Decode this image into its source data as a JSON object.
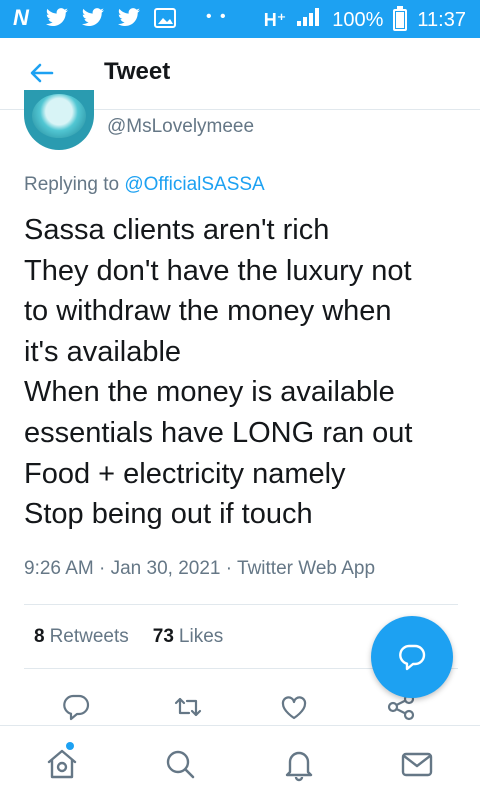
{
  "status_bar": {
    "network": "H⁺",
    "battery": "100%",
    "time": "11:37",
    "battery_level": 1.0
  },
  "header": {
    "title": "Tweet"
  },
  "tweet": {
    "handle": "@MsLovelymeee",
    "replying_prefix": "Replying to ",
    "replying_to": "@OfficialSASSA",
    "lines": [
      "Sassa clients aren't rich",
      "They don't have the luxury not",
      "to withdraw the money when",
      "it's available",
      "When the money is available",
      "essentials have LONG ran out",
      "Food + electricity namely",
      "Stop being out if touch"
    ],
    "time": "9:26 AM",
    "date": "Jan 30, 2021",
    "source": "Twitter Web App",
    "separator": " · "
  },
  "stats": {
    "retweets_count": "8",
    "retweets_label": "Retweets",
    "likes_count": "73",
    "likes_label": "Likes"
  },
  "colors": {
    "accent": "#1da1f2",
    "text": "#14171a",
    "secondary": "#657786",
    "divider": "#e1e8ed"
  },
  "icons": {
    "actions": [
      "reply-icon",
      "retweet-icon",
      "like-icon",
      "share-icon"
    ],
    "nav": [
      "home-icon",
      "search-icon",
      "notifications-icon",
      "messages-icon"
    ],
    "fab": "compose-reply-icon"
  }
}
